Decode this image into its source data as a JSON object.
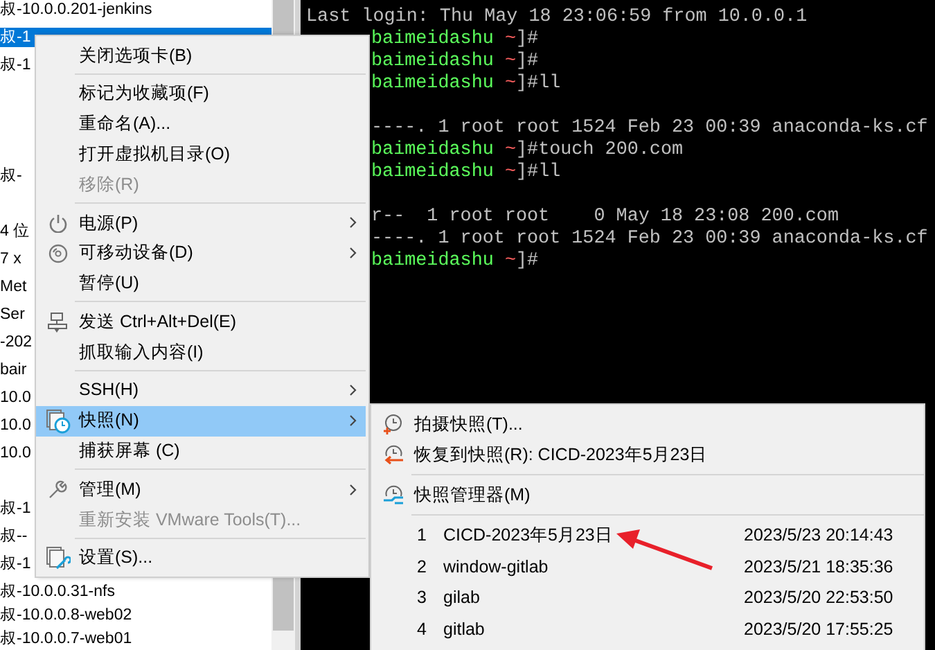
{
  "tree": {
    "rows": [
      {
        "kind": "text",
        "label": "叔-10.0.0.201-jenkins",
        "selected": false
      },
      {
        "kind": "text",
        "label": "叔-1",
        "selected": true
      },
      {
        "kind": "text",
        "label": "叔-1",
        "selected": false
      },
      {
        "kind": "gap"
      },
      {
        "kind": "gap"
      },
      {
        "kind": "gap"
      },
      {
        "kind": "text",
        "label": "叔-",
        "selected": false
      },
      {
        "kind": "gap"
      },
      {
        "kind": "text",
        "label": "4 位",
        "selected": false
      },
      {
        "kind": "text",
        "label": "7 x",
        "selected": false
      },
      {
        "kind": "text",
        "label": "Met",
        "selected": false
      },
      {
        "kind": "text",
        "label": "Ser",
        "selected": false
      },
      {
        "kind": "text",
        "label": "-202",
        "selected": false
      },
      {
        "kind": "text",
        "label": "bair",
        "selected": false
      },
      {
        "kind": "text",
        "label": "10.0",
        "selected": false
      },
      {
        "kind": "text",
        "label": "10.0",
        "selected": false
      },
      {
        "kind": "text",
        "label": "10.0",
        "selected": false
      },
      {
        "kind": "gap"
      },
      {
        "kind": "text",
        "label": "叔-1",
        "selected": false
      },
      {
        "kind": "text",
        "label": "叔--",
        "selected": false
      },
      {
        "kind": "text",
        "label": "叔-1",
        "selected": false
      },
      {
        "kind": "text",
        "label": "叔-10.0.0.31-nfs",
        "selected": false
      },
      {
        "kind": "text",
        "label": "叔-10.0.0.8-web02",
        "selected": false
      },
      {
        "kind": "text",
        "label": "叔-10.0.0.7-web01",
        "selected": false
      }
    ]
  },
  "terminal": {
    "lines": [
      {
        "kind": "gap"
      },
      {
        "kind": "plain",
        "text": "Last login: Thu May 18 23:06:59 from 10.0.0.1"
      },
      {
        "kind": "prompt",
        "host": "baimeidashu",
        "dir": "~",
        "tail": "]#"
      },
      {
        "kind": "prompt",
        "host": "baimeidashu",
        "dir": "~",
        "tail": "]#"
      },
      {
        "kind": "prompt",
        "host": "baimeidashu",
        "dir": "~",
        "tail": "]#ll"
      },
      {
        "kind": "gap"
      },
      {
        "kind": "cut",
        "text": "----. 1 root root 1524 Feb 23 00:39 anaconda-ks.cf"
      },
      {
        "kind": "prompt",
        "host": "baimeidashu",
        "dir": "~",
        "tail": "]#touch 200.com"
      },
      {
        "kind": "prompt",
        "host": "baimeidashu",
        "dir": "~",
        "tail": "]#ll"
      },
      {
        "kind": "gap"
      },
      {
        "kind": "cut",
        "text": "r--  1 root root    0 May 18 23:08 200.com"
      },
      {
        "kind": "cut",
        "text": "----. 1 root root 1524 Feb 23 00:39 anaconda-ks.cf"
      },
      {
        "kind": "prompt",
        "host": "baimeidashu",
        "dir": "~",
        "tail": "]#"
      }
    ]
  },
  "context_menu": {
    "items": [
      {
        "kind": "item",
        "label": "关闭选项卡(B)",
        "disabled": false,
        "submenu": false,
        "selected": false
      },
      {
        "kind": "separator"
      },
      {
        "kind": "item",
        "label": "标记为收藏项(F)",
        "disabled": false,
        "submenu": false,
        "selected": false
      },
      {
        "kind": "item",
        "label": "重命名(A)...",
        "disabled": false,
        "submenu": false,
        "selected": false
      },
      {
        "kind": "item",
        "label": "打开虚拟机目录(O)",
        "disabled": false,
        "submenu": false,
        "selected": false
      },
      {
        "kind": "item",
        "label": "移除(R)",
        "disabled": true,
        "submenu": false,
        "selected": false
      },
      {
        "kind": "separator"
      },
      {
        "kind": "item",
        "label": "电源(P)",
        "disabled": false,
        "submenu": true,
        "selected": false
      },
      {
        "kind": "item",
        "label": "可移动设备(D)",
        "disabled": false,
        "submenu": true,
        "selected": false
      },
      {
        "kind": "item",
        "label": "暂停(U)",
        "disabled": false,
        "submenu": false,
        "selected": false
      },
      {
        "kind": "separator"
      },
      {
        "kind": "item",
        "label": "发送 Ctrl+Alt+Del(E)",
        "disabled": false,
        "submenu": false,
        "selected": false
      },
      {
        "kind": "item",
        "label": "抓取输入内容(I)",
        "disabled": false,
        "submenu": false,
        "selected": false
      },
      {
        "kind": "separator"
      },
      {
        "kind": "item",
        "label": "SSH(H)",
        "disabled": false,
        "submenu": true,
        "selected": false
      },
      {
        "kind": "item",
        "label": "快照(N)",
        "disabled": false,
        "submenu": true,
        "selected": true
      },
      {
        "kind": "item",
        "label": "捕获屏幕 (C)",
        "disabled": false,
        "submenu": false,
        "selected": false
      },
      {
        "kind": "separator"
      },
      {
        "kind": "item",
        "label": "管理(M)",
        "disabled": false,
        "submenu": true,
        "selected": false
      },
      {
        "kind": "item",
        "label": "重新安装 VMware Tools(T)...",
        "disabled": true,
        "submenu": false,
        "selected": false
      },
      {
        "kind": "separator"
      },
      {
        "kind": "item",
        "label": "设置(S)...",
        "disabled": false,
        "submenu": false,
        "selected": false
      }
    ]
  },
  "snapshot_menu": {
    "items": [
      {
        "kind": "item",
        "label": "拍摄快照(T)..."
      },
      {
        "kind": "item",
        "label": "恢复到快照(R): CICD-2023年5月23日"
      },
      {
        "kind": "separator"
      },
      {
        "kind": "item",
        "label": "快照管理器(M)"
      },
      {
        "kind": "separator"
      }
    ],
    "snapshots": [
      {
        "number": "1",
        "name": "CICD-2023年5月23日",
        "date": "2023/5/23 20:14:43"
      },
      {
        "number": "2",
        "name": "window-gitlab",
        "date": "2023/5/21 18:35:36"
      },
      {
        "number": "3",
        "name": "gilab",
        "date": "2023/5/20 22:53:50"
      },
      {
        "number": "4",
        "name": "gitlab",
        "date": "2023/5/20 17:55:25"
      }
    ]
  }
}
